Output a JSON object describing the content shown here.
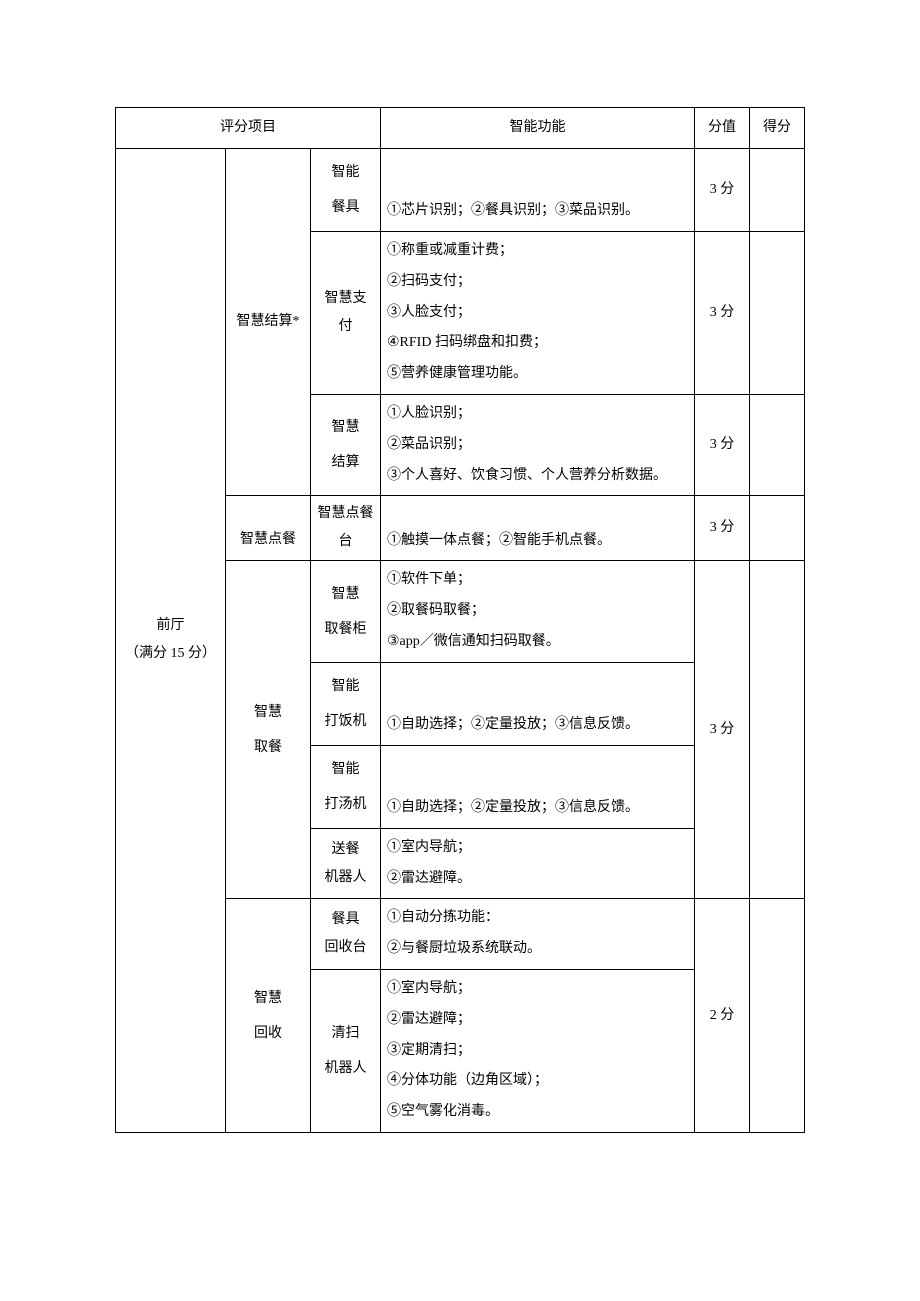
{
  "header": {
    "col_item": "评分项目",
    "col_func": "智能功能",
    "col_score": "分值",
    "col_got": "得分"
  },
  "area": {
    "name_line1": "前厅",
    "name_line2": "（满分 15 分）"
  },
  "groups": {
    "jiesuan": {
      "name": "智慧结算*",
      "rows": [
        {
          "sub": "智能餐具",
          "desc": "①芯片识别；②餐具识别；③菜品识别。",
          "score": "3 分"
        },
        {
          "sub": "智慧支付",
          "desc": "①称重或减重计费；\n②扫码支付；\n③人脸支付；\n④RFID 扫码绑盘和扣费；\n⑤营养健康管理功能。",
          "score": "3 分"
        },
        {
          "sub": "智慧结算",
          "desc": "①人脸识别；\n②菜品识别；\n③个人喜好、饮食习惯、个人营养分析数据。",
          "score": "3 分"
        }
      ]
    },
    "diancan": {
      "name": "智慧点餐",
      "rows": [
        {
          "sub": "智慧点餐台",
          "desc": "①触摸一体点餐；②智能手机点餐。",
          "score": "3 分"
        }
      ]
    },
    "qucan": {
      "name": "智慧取餐",
      "rows": [
        {
          "sub": "智慧取餐柜",
          "desc": "①软件下单；\n②取餐码取餐；\n③app／微信通知扫码取餐。"
        },
        {
          "sub": "智能打饭机",
          "desc": "①自助选择；②定量投放；③信息反馈。"
        },
        {
          "sub": "智能打汤机",
          "desc": "①自助选择；②定量投放；③信息反馈。"
        },
        {
          "sub": "送餐机器人",
          "desc": "①室内导航；\n②雷达避障。"
        }
      ],
      "score": "3 分"
    },
    "huishou": {
      "name": "智慧回收",
      "rows": [
        {
          "sub": "餐具回收台",
          "desc": "①自动分拣功能：\n②与餐厨垃圾系统联动。"
        },
        {
          "sub": "清扫机器人",
          "desc": "①室内导航；\n②雷达避障；\n③定期清扫；\n④分体功能（边角区域）；\n⑤空气雾化消毒。"
        }
      ],
      "score": "2 分"
    }
  }
}
